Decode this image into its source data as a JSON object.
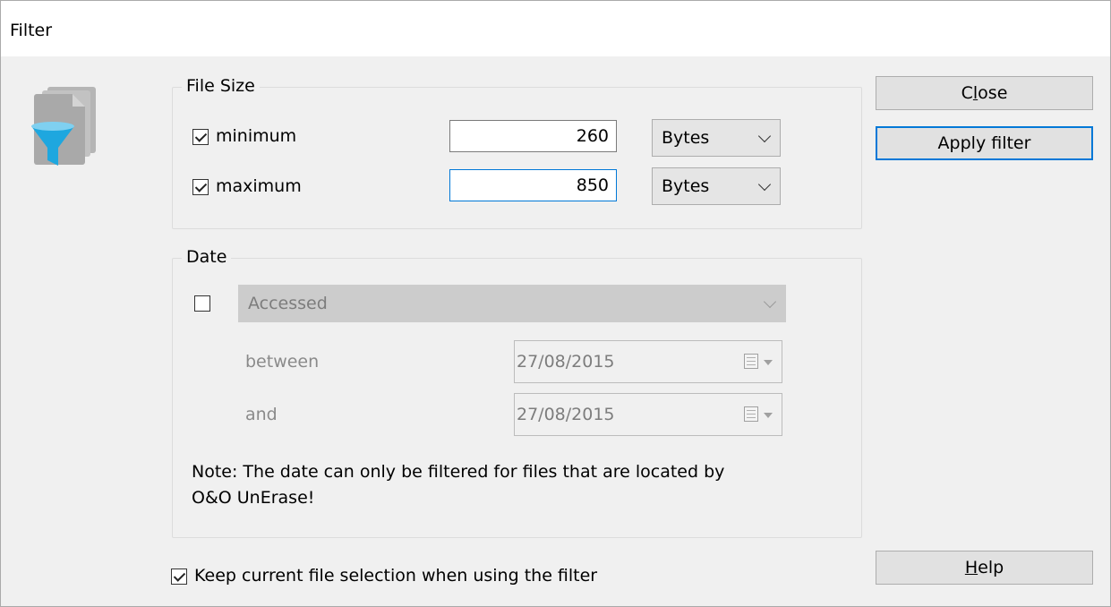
{
  "window": {
    "title": "Filter"
  },
  "app_icon": {
    "name": "file-filter-icon"
  },
  "file_size": {
    "title": "File Size",
    "minimum": {
      "label": "minimum",
      "checked": true,
      "value": "260",
      "unit": "Bytes"
    },
    "maximum": {
      "label": "maximum",
      "checked": true,
      "value": "850",
      "unit": "Bytes"
    }
  },
  "date": {
    "title": "Date",
    "enabled": false,
    "type_select": "Accessed",
    "between_label": "between",
    "and_label": "and",
    "from_date": "27/08/2015",
    "to_date": "27/08/2015",
    "note_line1": "Note: The date can only be filtered for files that are located by",
    "note_line2": "O&O UnErase!"
  },
  "buttons": {
    "close": {
      "pre": "C",
      "acc": "l",
      "post": "ose"
    },
    "apply": "Apply filter",
    "help": {
      "pre": "",
      "acc": "H",
      "post": "elp"
    }
  },
  "keep_selection": {
    "label": "Keep current file selection when using the filter",
    "checked": true
  },
  "colors": {
    "accent": "#0078d7",
    "window_bg": "#f0f0f0",
    "titlebar_bg": "#ffffff"
  }
}
